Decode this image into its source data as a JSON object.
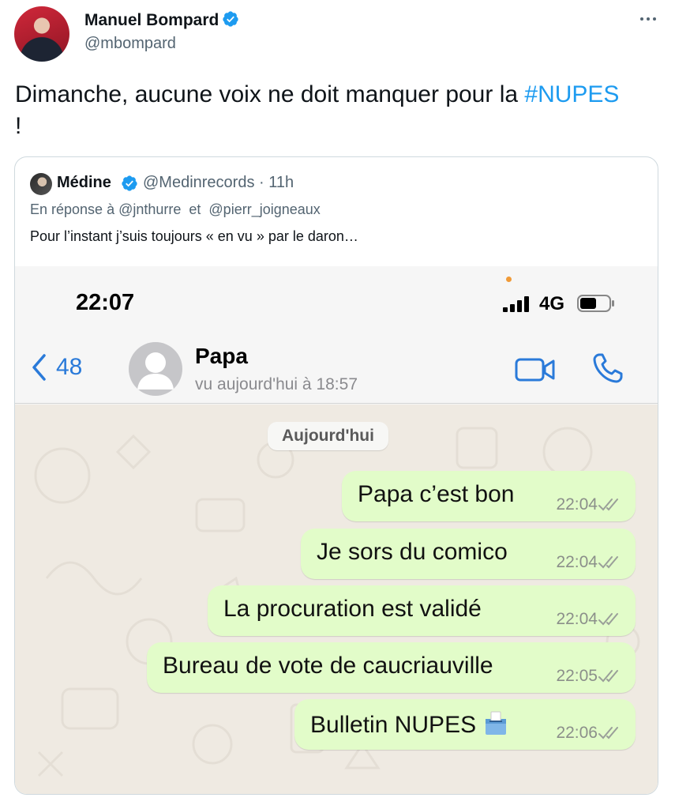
{
  "tweet": {
    "author_name": "Manuel Bompard",
    "author_handle": "@mbompard",
    "text_before": "Dimanche, aucune voix ne doit manquer pour la ",
    "hashtag": "#NUPES",
    "text_after": " !"
  },
  "quote": {
    "author_name": "Médine",
    "author_handle": "@Medinrecords",
    "separator": " · ",
    "time_ago": "11h",
    "reply_prefix": "En réponse à ",
    "mention_1": "@jnthurre",
    "reply_and": "  et  ",
    "mention_2": "@pierr_joigneaux",
    "text": "Pour l’instant j’suis toujours « en vu » par le daron…"
  },
  "phone": {
    "clock": "22:07",
    "network": "4G",
    "back_count": "48",
    "contact_name": "Papa",
    "contact_status": "vu aujourd'hui à 18:57",
    "date_label": "Aujourd'hui",
    "messages": [
      {
        "text": "Papa c’est bon",
        "time": "22:04"
      },
      {
        "text": "Je sors du comico",
        "time": "22:04"
      },
      {
        "text": "La procuration est validé",
        "time": "22:04"
      },
      {
        "text": "Bureau de vote de caucriauville",
        "time": "22:05"
      },
      {
        "text": "Bulletin NUPES",
        "time": "22:06",
        "emoji": "ballot-box-icon"
      }
    ]
  },
  "colors": {
    "link_blue": "#1d9bf0",
    "ios_blue": "#2a7ad9",
    "bubble_green": "#e2fcc9",
    "chat_background": "#efeae2"
  }
}
